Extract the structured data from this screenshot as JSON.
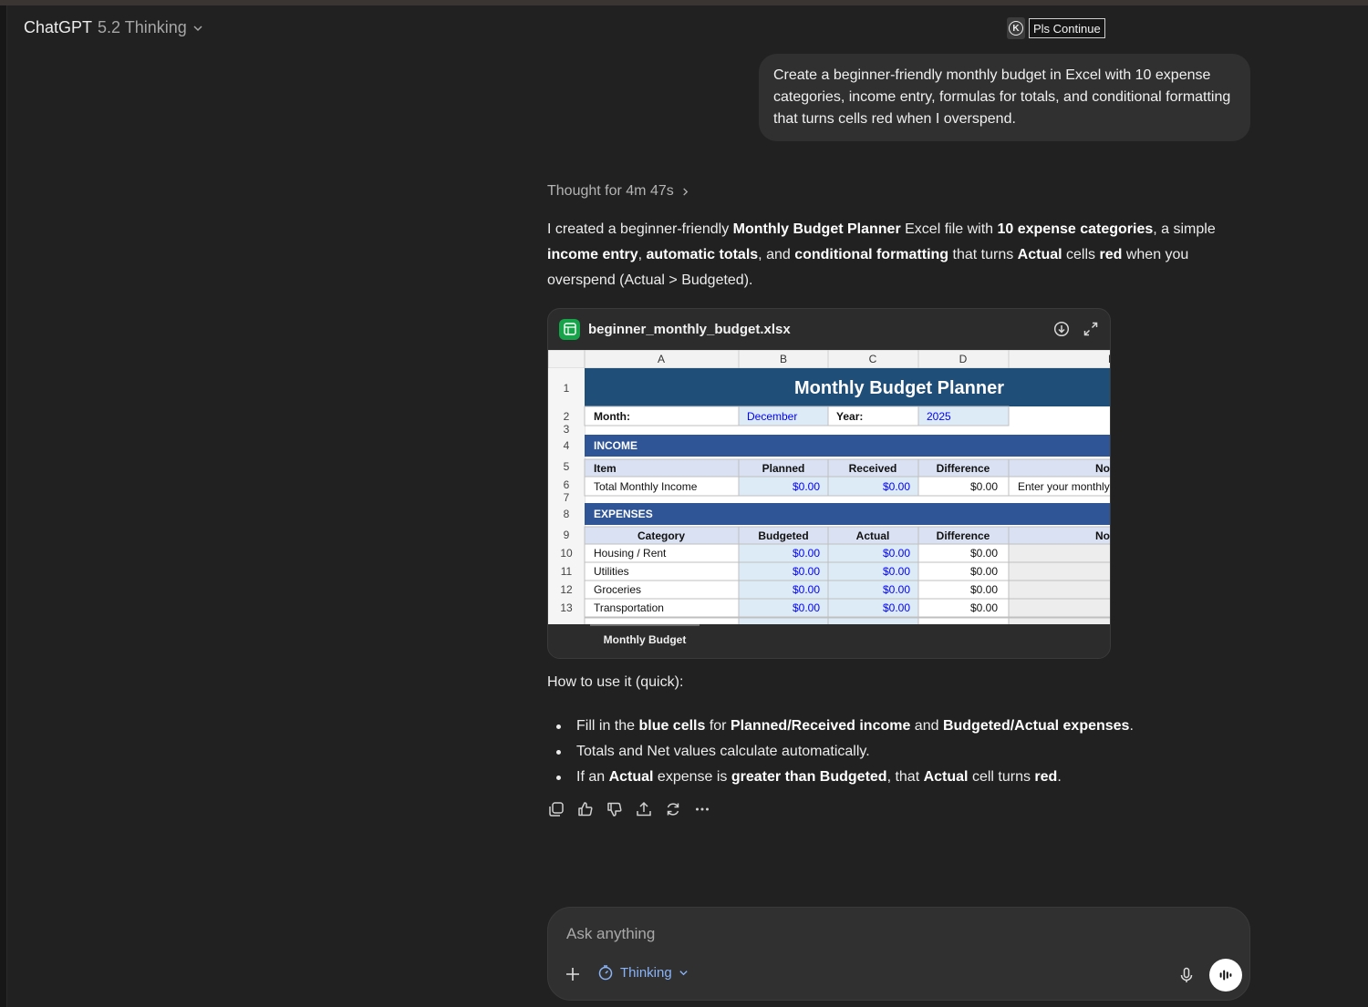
{
  "header": {
    "model_name": "ChatGPT",
    "model_version": "5.2 Thinking",
    "extension_letter": "K",
    "extension_button": "Pls Continue"
  },
  "user_message": "Create a beginner-friendly monthly budget in Excel with 10 expense categories, income entry, formulas for totals, and conditional formatting that turns cells red when I overspend.",
  "assistant": {
    "thought_label": "Thought for 4m 47s",
    "intro_parts": [
      {
        "text": "I created a beginner-friendly ",
        "bold": false
      },
      {
        "text": "Monthly Budget Planner",
        "bold": true
      },
      {
        "text": " Excel file with ",
        "bold": false
      },
      {
        "text": "10 expense categories",
        "bold": true
      },
      {
        "text": ", a simple ",
        "bold": false
      },
      {
        "text": "income entry",
        "bold": true
      },
      {
        "text": ", ",
        "bold": false
      },
      {
        "text": "automatic totals",
        "bold": true
      },
      {
        "text": ", and ",
        "bold": false
      },
      {
        "text": "conditional formatting",
        "bold": true
      },
      {
        "text": " that turns ",
        "bold": false
      },
      {
        "text": "Actual",
        "bold": true
      },
      {
        "text": " cells ",
        "bold": false
      },
      {
        "text": "red",
        "bold": true
      },
      {
        "text": " when you overspend (Actual > Budgeted).",
        "bold": false
      }
    ],
    "howto_title": "How to use it (quick):",
    "bullets": [
      [
        {
          "text": "Fill in the ",
          "bold": false
        },
        {
          "text": "blue cells",
          "bold": true
        },
        {
          "text": " for ",
          "bold": false
        },
        {
          "text": "Planned/Received income",
          "bold": true
        },
        {
          "text": " and ",
          "bold": false
        },
        {
          "text": "Budgeted/Actual expenses",
          "bold": true
        },
        {
          "text": ".",
          "bold": false
        }
      ],
      [
        {
          "text": "Totals and Net values calculate automatically.",
          "bold": false
        }
      ],
      [
        {
          "text": "If an ",
          "bold": false
        },
        {
          "text": "Actual",
          "bold": true
        },
        {
          "text": " expense is ",
          "bold": false
        },
        {
          "text": "greater than Budgeted",
          "bold": true
        },
        {
          "text": ", that ",
          "bold": false
        },
        {
          "text": "Actual",
          "bold": true
        },
        {
          "text": " cell turns ",
          "bold": false
        },
        {
          "text": "red",
          "bold": true
        },
        {
          "text": ".",
          "bold": false
        }
      ]
    ],
    "action_icons": [
      "copy-icon",
      "thumbs-up-icon",
      "thumbs-down-icon",
      "share-icon",
      "regenerate-icon",
      "more-icon"
    ]
  },
  "file": {
    "name": "beginner_monthly_budget.xlsx",
    "icons": [
      "download-icon",
      "expand-icon"
    ],
    "sheet_tab": "Monthly Budget"
  },
  "sheet": {
    "columns": [
      "A",
      "B",
      "C",
      "D",
      "E"
    ],
    "title": "Monthly Budget Planner",
    "month_label": "Month:",
    "month_value": "December",
    "year_label": "Year:",
    "year_value": "2025",
    "income_header": "INCOME",
    "income_columns": [
      "Item",
      "Planned",
      "Received",
      "Difference",
      "No"
    ],
    "income_row": {
      "item": "Total Monthly Income",
      "planned": "$0.00",
      "received": "$0.00",
      "difference": "$0.00",
      "notes": "Enter your monthly"
    },
    "expenses_header": "EXPENSES",
    "expense_columns": [
      "Category",
      "Budgeted",
      "Actual",
      "Difference",
      "No"
    ],
    "expense_rows": [
      {
        "row": "10",
        "category": "Housing / Rent",
        "budgeted": "$0.00",
        "actual": "$0.00",
        "difference": "$0.00"
      },
      {
        "row": "11",
        "category": "Utilities",
        "budgeted": "$0.00",
        "actual": "$0.00",
        "difference": "$0.00"
      },
      {
        "row": "12",
        "category": "Groceries",
        "budgeted": "$0.00",
        "actual": "$0.00",
        "difference": "$0.00"
      },
      {
        "row": "13",
        "category": "Transportation",
        "budgeted": "$0.00",
        "actual": "$0.00",
        "difference": "$0.00"
      }
    ],
    "colors": {
      "header_fill": "#1f4e79",
      "section_fill": "#2f5597",
      "column_header_fill": "#d9e1f2",
      "input_fill": "#ddebf7",
      "input_text": "#0000ff",
      "notes_fill": "#ededed"
    }
  },
  "composer": {
    "placeholder": "Ask anything",
    "mode_label": "Thinking"
  }
}
